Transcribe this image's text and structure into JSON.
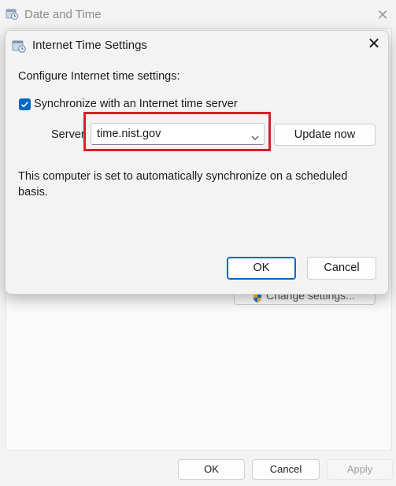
{
  "background_window": {
    "title": "Date and Time",
    "icon": "date-time-icon",
    "close_icon": "close-icon",
    "change_settings_label": "Change settings...",
    "footer": {
      "ok_label": "OK",
      "cancel_label": "Cancel",
      "apply_label": "Apply"
    }
  },
  "dialog": {
    "title": "Internet Time Settings",
    "icon": "internet-time-icon",
    "close_icon": "close-icon",
    "configure_label": "Configure Internet time settings:",
    "sync": {
      "label": "Synchronize with an Internet time server",
      "checked": true
    },
    "server": {
      "label": "Server",
      "value": "time.nist.gov",
      "dropdown_icon": "chevron-down-icon"
    },
    "update_now_label": "Update now",
    "status_text": "This computer is set to automatically synchronize on a scheduled basis.",
    "ok_label": "OK",
    "cancel_label": "Cancel"
  },
  "colors": {
    "accent": "#0067c0",
    "highlight": "#d81f2a",
    "window_bg": "#f3f3f3"
  }
}
